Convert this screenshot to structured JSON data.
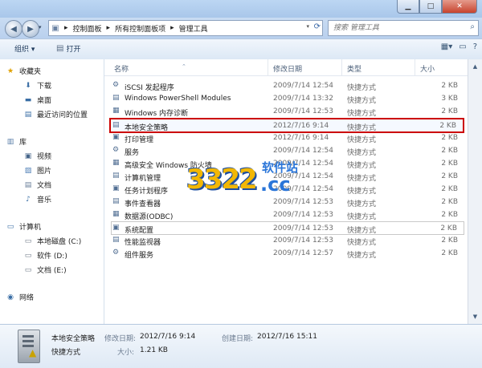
{
  "window": {
    "min_icon": "minimize-icon",
    "max_icon": "maximize-icon",
    "close_icon": "close-icon",
    "min_glyph": "▁",
    "max_glyph": "□",
    "close_glyph": "✕"
  },
  "nav": {
    "back_glyph": "◀",
    "forward_glyph": "▶",
    "breadcrumb": [
      "控制面板",
      "所有控制面板项",
      "管理工具"
    ],
    "separator": "▸",
    "search_placeholder": "搜索 管理工具"
  },
  "toolbar": {
    "organize_label": "组织 ▾",
    "open_label": "打开"
  },
  "sidebar": {
    "favorites": {
      "label": "收藏夹",
      "items": [
        "下载",
        "桌面",
        "最近访问的位置"
      ]
    },
    "libraries": {
      "label": "库",
      "items": [
        "视频",
        "图片",
        "文档",
        "音乐"
      ]
    },
    "computer": {
      "label": "计算机",
      "items": [
        "本地磁盘 (C:)",
        "软件 (D:)",
        "文档 (E:)"
      ]
    },
    "network": {
      "label": "网络"
    }
  },
  "columns": {
    "name": "名称",
    "date": "修改日期",
    "type": "类型",
    "size": "大小"
  },
  "files": [
    {
      "name": "iSCSI 发起程序",
      "date": "2009/7/14 12:54",
      "type": "快捷方式",
      "size": "2 KB"
    },
    {
      "name": "Windows PowerShell Modules",
      "date": "2009/7/14 13:32",
      "type": "快捷方式",
      "size": "3 KB"
    },
    {
      "name": "Windows 内存诊断",
      "date": "2009/7/14 12:53",
      "type": "快捷方式",
      "size": "2 KB"
    },
    {
      "name": "本地安全策略",
      "date": "2012/7/16 9:14",
      "type": "快捷方式",
      "size": "2 KB"
    },
    {
      "name": "打印管理",
      "date": "2012/7/16 9:14",
      "type": "快捷方式",
      "size": "2 KB"
    },
    {
      "name": "服务",
      "date": "2009/7/14 12:54",
      "type": "快捷方式",
      "size": "2 KB"
    },
    {
      "name": "高级安全 Windows 防火墙",
      "date": "2009/7/14 12:54",
      "type": "快捷方式",
      "size": "2 KB"
    },
    {
      "name": "计算机管理",
      "date": "2009/7/14 12:54",
      "type": "快捷方式",
      "size": "2 KB"
    },
    {
      "name": "任务计划程序",
      "date": "2009/7/14 12:54",
      "type": "快捷方式",
      "size": "2 KB"
    },
    {
      "name": "事件查看器",
      "date": "2009/7/14 12:53",
      "type": "快捷方式",
      "size": "2 KB"
    },
    {
      "name": "数据源(ODBC)",
      "date": "2009/7/14 12:53",
      "type": "快捷方式",
      "size": "2 KB"
    },
    {
      "name": "系统配置",
      "date": "2009/7/14 12:53",
      "type": "快捷方式",
      "size": "2 KB"
    },
    {
      "name": "性能监视器",
      "date": "2009/7/14 12:53",
      "type": "快捷方式",
      "size": "2 KB"
    },
    {
      "name": "组件服务",
      "date": "2009/7/14 12:57",
      "type": "快捷方式",
      "size": "2 KB"
    }
  ],
  "watermark": {
    "number": "3322",
    "domain": ".cc",
    "site": "软件站"
  },
  "details": {
    "name": "本地安全策略",
    "type": "快捷方式",
    "modified_label": "修改日期:",
    "modified_value": "2012/7/16 9:14",
    "created_label": "创建日期:",
    "created_value": "2012/7/16 15:11",
    "size_label": "大小:",
    "size_value": "1.21 KB"
  }
}
